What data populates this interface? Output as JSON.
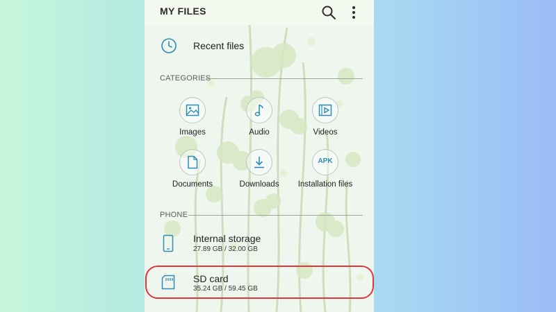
{
  "app": {
    "title": "MY FILES",
    "icons": {
      "search": "search-icon",
      "more": "more-vertical-icon"
    }
  },
  "recent": {
    "label": "Recent files",
    "icon": "clock-icon"
  },
  "categories": {
    "header": "CATEGORIES",
    "items": [
      {
        "label": "Images",
        "icon": "image-icon"
      },
      {
        "label": "Audio",
        "icon": "music-note-icon"
      },
      {
        "label": "Videos",
        "icon": "video-icon"
      },
      {
        "label": "Documents",
        "icon": "document-icon"
      },
      {
        "label": "Downloads",
        "icon": "download-icon"
      },
      {
        "label": "Installation files",
        "icon": "apk-icon",
        "badge": "APK"
      }
    ]
  },
  "phone": {
    "header": "PHONE",
    "storage": [
      {
        "label": "Internal storage",
        "usage": "27.89 GB / 32.00 GB",
        "icon": "phone-icon"
      },
      {
        "label": "SD card",
        "usage": "35.24 GB / 59.45 GB",
        "icon": "sd-card-icon",
        "highlighted": true
      }
    ]
  },
  "colors": {
    "accent": "#2e8bb7",
    "highlight": "#e0343e",
    "bg_left": "#c6f6dc",
    "bg_right": "#9bbcf7"
  }
}
